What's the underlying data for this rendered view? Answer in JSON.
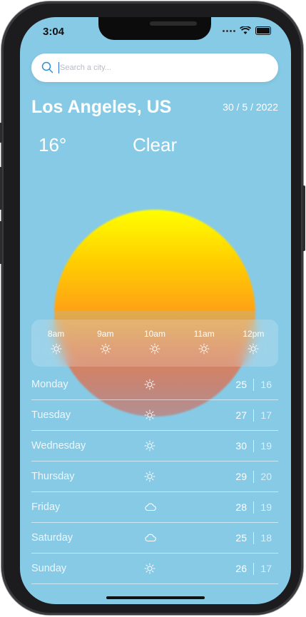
{
  "status_bar": {
    "time": "3:04"
  },
  "search": {
    "placeholder": "Search a city..."
  },
  "location": {
    "city": "Los Angeles, US",
    "date": "30 / 5 / 2022"
  },
  "current": {
    "temperature": "16°",
    "condition": "Clear"
  },
  "hourly": [
    {
      "time": "8am",
      "icon": "sun-icon"
    },
    {
      "time": "9am",
      "icon": "sun-icon"
    },
    {
      "time": "10am",
      "icon": "sun-icon"
    },
    {
      "time": "11am",
      "icon": "sun-icon"
    },
    {
      "time": "12pm",
      "icon": "sun-icon"
    }
  ],
  "daily": [
    {
      "day": "Monday",
      "icon": "sun-icon",
      "max": "25",
      "min": "16"
    },
    {
      "day": "Tuesday",
      "icon": "sun-icon",
      "max": "27",
      "min": "17"
    },
    {
      "day": "Wednesday",
      "icon": "sun-icon",
      "max": "30",
      "min": "19"
    },
    {
      "day": "Thursday",
      "icon": "sun-icon",
      "max": "29",
      "min": "20"
    },
    {
      "day": "Friday",
      "icon": "cloud-icon",
      "max": "28",
      "min": "19"
    },
    {
      "day": "Saturday",
      "icon": "cloud-icon",
      "max": "25",
      "min": "18"
    },
    {
      "day": "Sunday",
      "icon": "sun-icon",
      "max": "26",
      "min": "17"
    }
  ],
  "colors": {
    "background": "#87cae6",
    "sun_top": "#ffff00",
    "sun_bottom": "#ff2a00"
  }
}
